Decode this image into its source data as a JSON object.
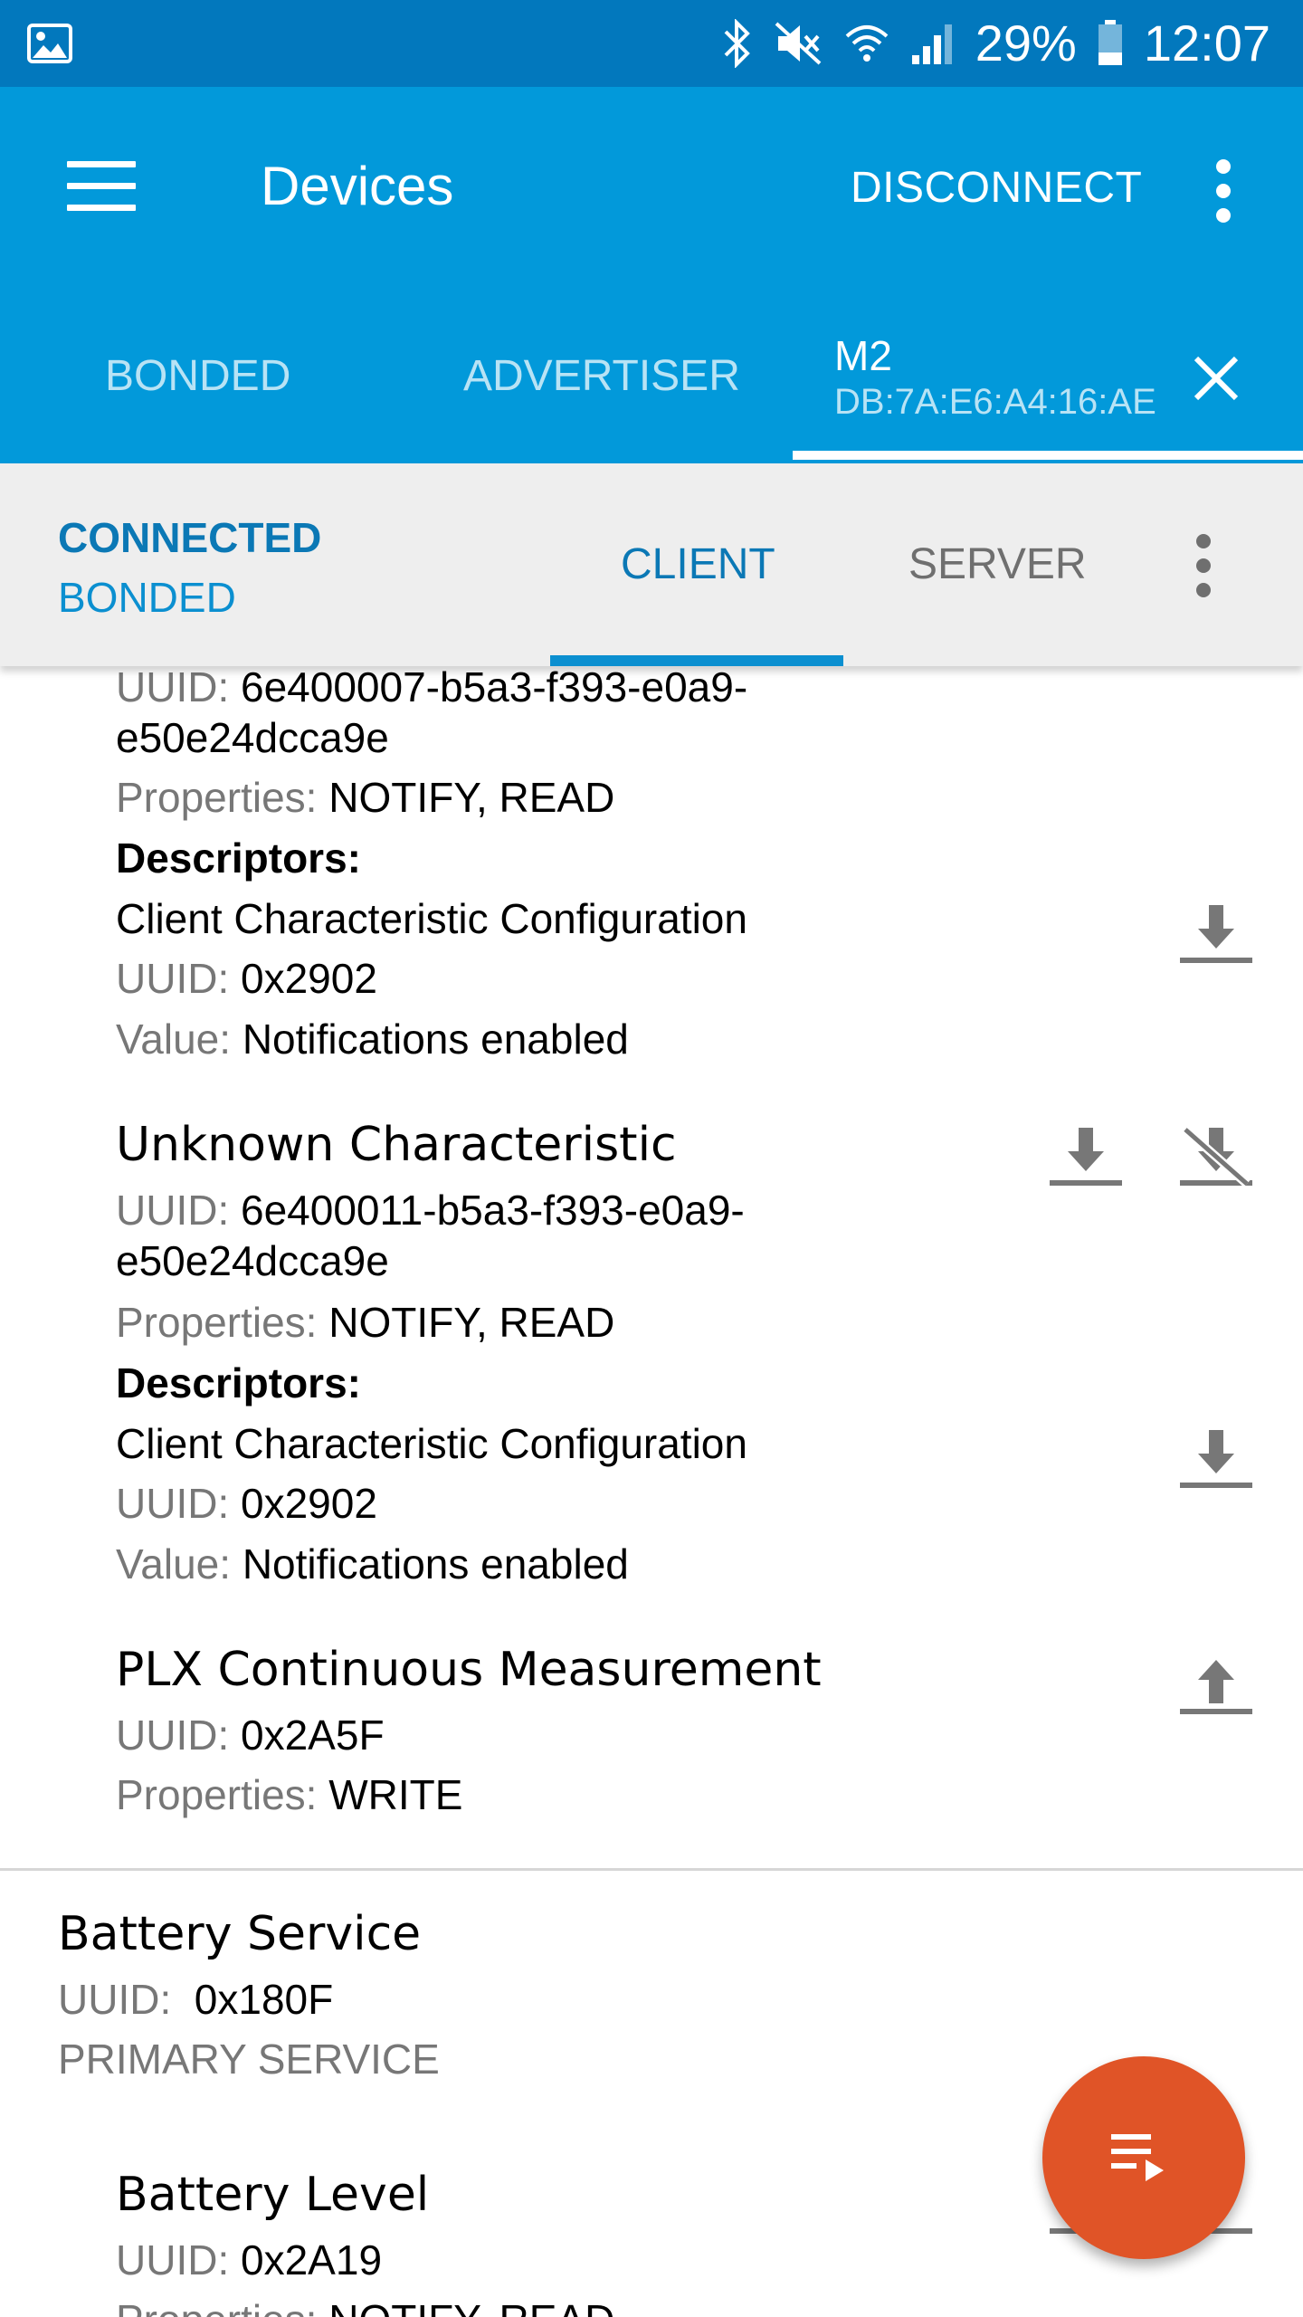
{
  "status_bar": {
    "battery": "29%",
    "time": "12:07",
    "icons": [
      "gallery-icon",
      "bluetooth-icon",
      "mute-icon",
      "wifi-icon",
      "signal-icon",
      "battery-icon"
    ]
  },
  "app_bar": {
    "title": "Devices",
    "disconnect_label": "DISCONNECT",
    "tabs": [
      {
        "label": "BONDED"
      },
      {
        "label": "ADVERTISER"
      },
      {
        "label": "M2",
        "subtitle": "DB:7A:E6:A4:16:AE"
      }
    ]
  },
  "connection": {
    "state": "CONNECTED",
    "bond": "BONDED",
    "tabs": [
      {
        "label": "CLIENT"
      },
      {
        "label": "SERVER"
      }
    ]
  },
  "labels": {
    "uuid": "UUID:",
    "properties": "Properties:",
    "descriptors": "Descriptors:",
    "value": "Value:"
  },
  "characteristics": [
    {
      "uuid_line1": "6e400007-b5a3-f393-e0a9-",
      "uuid_line2": "e50e24dcca9e",
      "properties": "NOTIFY, READ",
      "descriptor": {
        "name": "Client Characteristic Configuration",
        "uuid": "0x2902",
        "value": "Notifications enabled"
      }
    },
    {
      "name": "Unknown Characteristic",
      "uuid_line1": "6e400011-b5a3-f393-e0a9-",
      "uuid_line2": "e50e24dcca9e",
      "properties": "NOTIFY, READ",
      "descriptor": {
        "name": "Client Characteristic Configuration",
        "uuid": "0x2902",
        "value": "Notifications enabled"
      }
    },
    {
      "name": "PLX Continuous Measurement",
      "uuid": "0x2A5F",
      "properties": "WRITE"
    }
  ],
  "service": {
    "name": "Battery Service",
    "uuid": "0x180F",
    "type": "PRIMARY SERVICE"
  },
  "battery_characteristic": {
    "name": "Battery Level",
    "uuid": "0x2A19",
    "properties": "NOTIFY, READ"
  },
  "colors": {
    "status_bar": "#0278bd",
    "app_bar": "#0299da",
    "accent": "#0b78b5",
    "fab": "#e05427"
  }
}
